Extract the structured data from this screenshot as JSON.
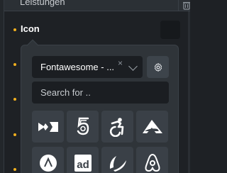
{
  "field_above": {
    "label": "Leistungen"
  },
  "control": {
    "label": "Icon"
  },
  "picker": {
    "library_select": {
      "value": "Fontawesome - ...",
      "clear_glyph": "×"
    },
    "search": {
      "placeholder": "Search for .."
    },
    "icons": [
      "fa-brand-icon-bowtie",
      "fa-brand-icon-500px",
      "fa-brand-icon-accessible",
      "fa-brand-icon-accusoft",
      "fa-brand-icon-adversal",
      "fa-brand-icon-adn",
      "fa-brand-icon-affiliatetheme",
      "fa-brand-icon-airbnb"
    ]
  },
  "colors": {
    "accent_dot": "#f2b01e",
    "panel": "#2f3439",
    "tile": "#3a4047",
    "input_bg": "#1b1e22"
  }
}
